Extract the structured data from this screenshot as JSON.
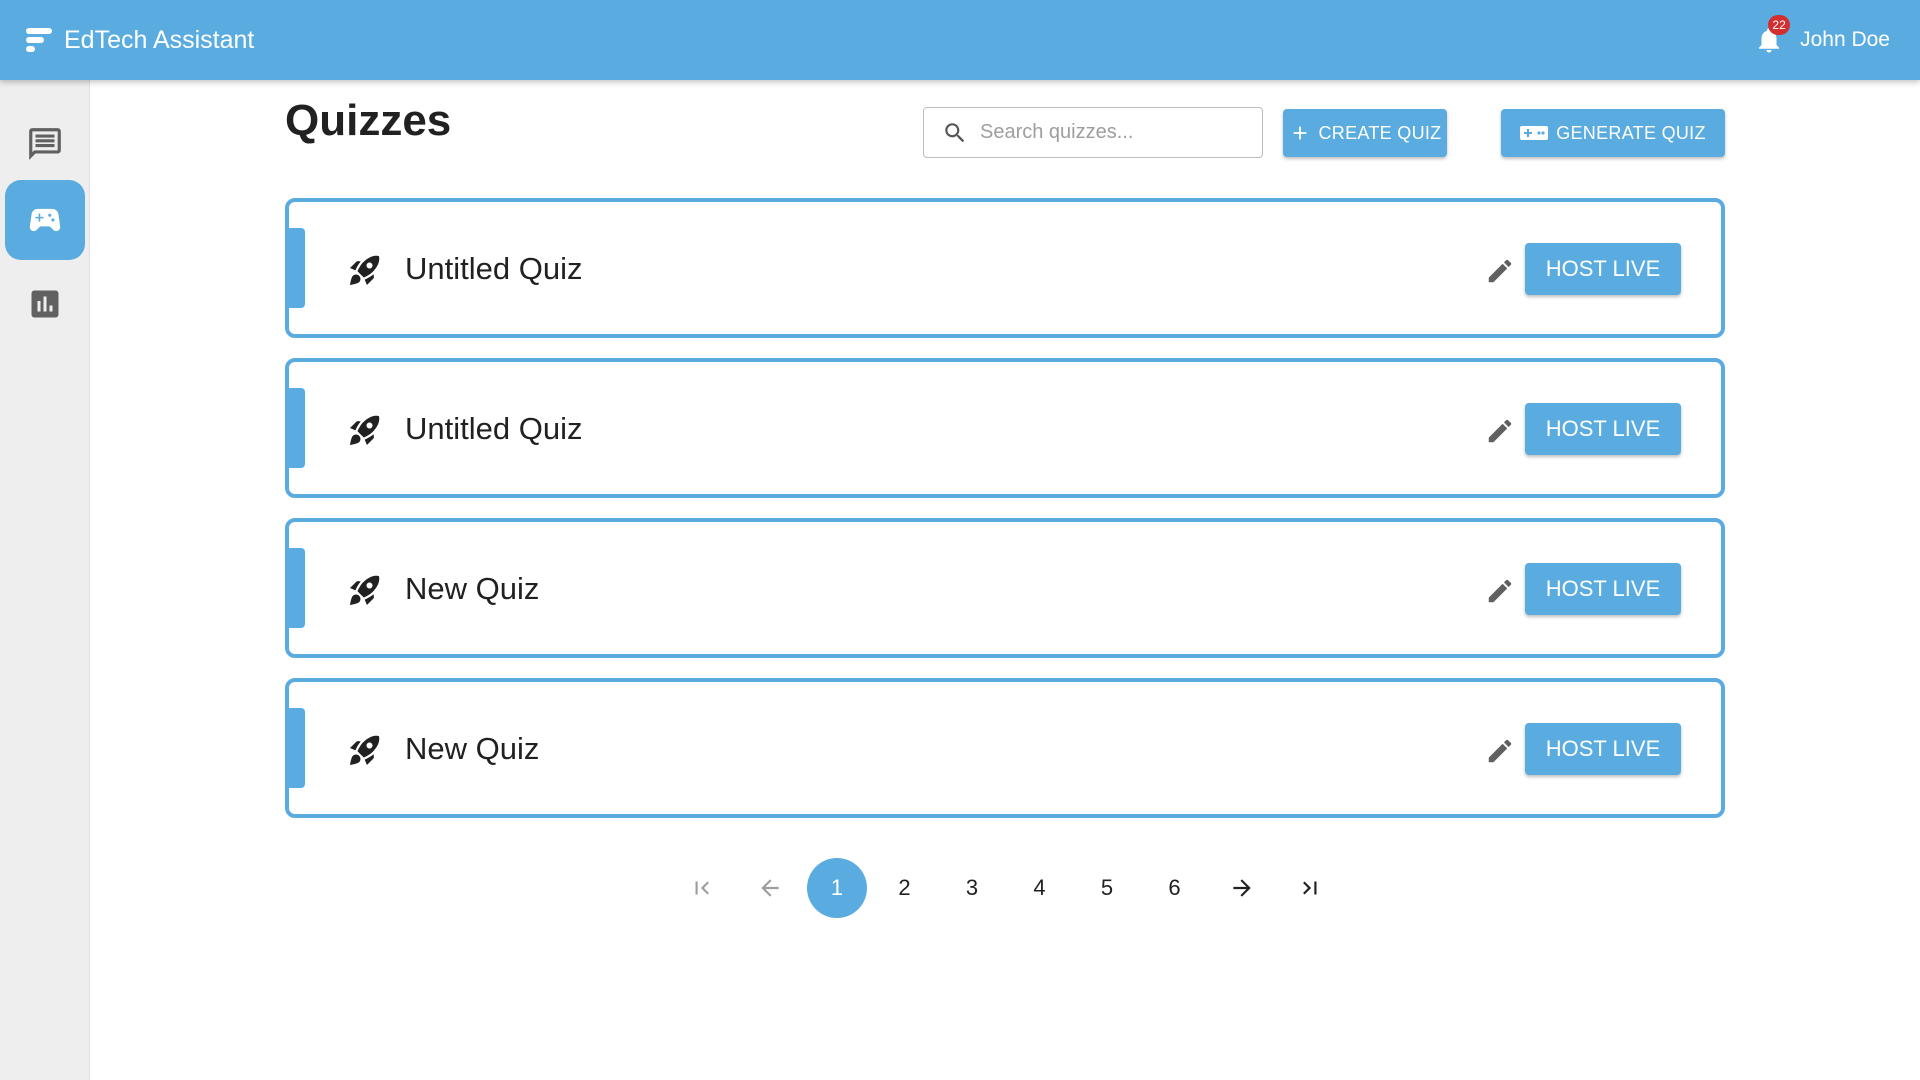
{
  "app": {
    "title": "EdTech Assistant",
    "notification_count": "22",
    "user_name": "John Doe",
    "accent_color": "#5aace0"
  },
  "sidebar": {
    "items": [
      {
        "icon": "chat-icon",
        "active": false
      },
      {
        "icon": "gamepad-icon",
        "active": true
      },
      {
        "icon": "bar-chart-icon",
        "active": false
      }
    ]
  },
  "page": {
    "title": "Quizzes",
    "search_placeholder": "Search quizzes...",
    "create_label": "CREATE QUIZ",
    "generate_label": "GENERATE QUIZ"
  },
  "quizzes": [
    {
      "title": "Untitled Quiz",
      "host_label": "HOST LIVE"
    },
    {
      "title": "Untitled Quiz",
      "host_label": "HOST LIVE"
    },
    {
      "title": "New Quiz",
      "host_label": "HOST LIVE"
    },
    {
      "title": "New Quiz",
      "host_label": "HOST LIVE"
    }
  ],
  "pagination": {
    "pages": [
      "1",
      "2",
      "3",
      "4",
      "5",
      "6"
    ],
    "current": "1"
  }
}
